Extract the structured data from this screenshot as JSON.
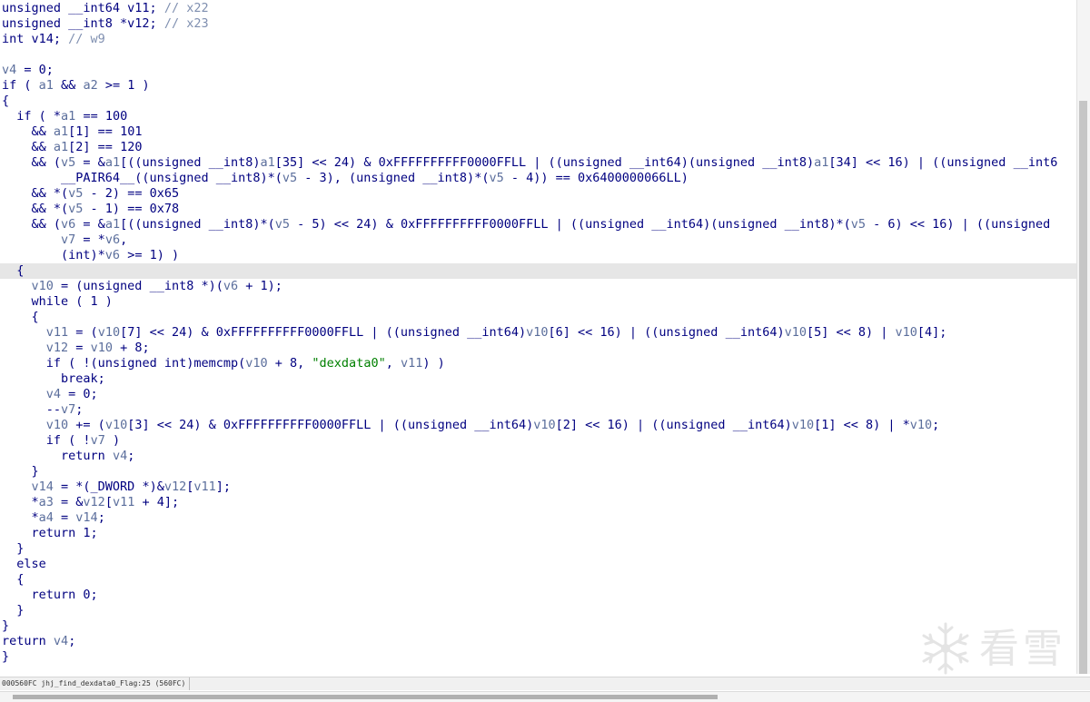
{
  "editor": {
    "highlighted_line": 17,
    "lines": [
      [
        [
          "kw",
          "unsigned __int64 v11; "
        ],
        [
          "cmt",
          "// x22"
        ]
      ],
      [
        [
          "kw",
          "unsigned __int8 *v12; "
        ],
        [
          "cmt",
          "// x23"
        ]
      ],
      [
        [
          "kw",
          "int v14; "
        ],
        [
          "cmt",
          "// w9"
        ]
      ],
      [],
      [
        [
          "var",
          "v4"
        ],
        [
          "txt",
          " = 0;"
        ]
      ],
      [
        [
          "kw",
          "if"
        ],
        [
          "txt",
          " ( "
        ],
        [
          "var",
          "a1"
        ],
        [
          "txt",
          " && "
        ],
        [
          "var",
          "a2"
        ],
        [
          "txt",
          " >= 1 )"
        ]
      ],
      [
        [
          "txt",
          "{"
        ]
      ],
      [
        [
          "txt",
          "  "
        ],
        [
          "kw",
          "if"
        ],
        [
          "txt",
          " ( *"
        ],
        [
          "var",
          "a1"
        ],
        [
          "txt",
          " == 100"
        ]
      ],
      [
        [
          "txt",
          "    && "
        ],
        [
          "var",
          "a1"
        ],
        [
          "txt",
          "[1] == 101"
        ]
      ],
      [
        [
          "txt",
          "    && "
        ],
        [
          "var",
          "a1"
        ],
        [
          "txt",
          "[2] == 120"
        ]
      ],
      [
        [
          "txt",
          "    && ("
        ],
        [
          "var",
          "v5"
        ],
        [
          "txt",
          " = &"
        ],
        [
          "var",
          "a1"
        ],
        [
          "txt",
          "[((unsigned __int8)"
        ],
        [
          "var",
          "a1"
        ],
        [
          "txt",
          "[35] << 24) & 0xFFFFFFFFFF0000FFLL | ((unsigned __int64)(unsigned __int8)"
        ],
        [
          "var",
          "a1"
        ],
        [
          "txt",
          "[34] << 16) | ((unsigned __int6"
        ]
      ],
      [
        [
          "txt",
          "        __PAIR64__((unsigned __int8)*("
        ],
        [
          "var",
          "v5"
        ],
        [
          "txt",
          " - 3), (unsigned __int8)*("
        ],
        [
          "var",
          "v5"
        ],
        [
          "txt",
          " - 4)) == 0x6400000066LL)"
        ]
      ],
      [
        [
          "txt",
          "    && *("
        ],
        [
          "var",
          "v5"
        ],
        [
          "txt",
          " - 2) == 0x65"
        ]
      ],
      [
        [
          "txt",
          "    && *("
        ],
        [
          "var",
          "v5"
        ],
        [
          "txt",
          " - 1) == 0x78"
        ]
      ],
      [
        [
          "txt",
          "    && ("
        ],
        [
          "var",
          "v6"
        ],
        [
          "txt",
          " = &"
        ],
        [
          "var",
          "a1"
        ],
        [
          "txt",
          "[((unsigned __int8)*("
        ],
        [
          "var",
          "v5"
        ],
        [
          "txt",
          " - 5) << 24) & 0xFFFFFFFFFF0000FFLL | ((unsigned __int64)(unsigned __int8)*("
        ],
        [
          "var",
          "v5"
        ],
        [
          "txt",
          " - 6) << 16) | ((unsigned"
        ]
      ],
      [
        [
          "txt",
          "        "
        ],
        [
          "var",
          "v7"
        ],
        [
          "txt",
          " = *"
        ],
        [
          "var",
          "v6"
        ],
        [
          "txt",
          ","
        ]
      ],
      [
        [
          "txt",
          "        (int)*"
        ],
        [
          "var",
          "v6"
        ],
        [
          "txt",
          " >= 1) )"
        ]
      ],
      [
        [
          "txt",
          "  {"
        ]
      ],
      [
        [
          "txt",
          "    "
        ],
        [
          "var",
          "v10"
        ],
        [
          "txt",
          " = (unsigned __int8 *)("
        ],
        [
          "var",
          "v6"
        ],
        [
          "txt",
          " + 1);"
        ]
      ],
      [
        [
          "txt",
          "    "
        ],
        [
          "kw",
          "while"
        ],
        [
          "txt",
          " ( 1 )"
        ]
      ],
      [
        [
          "txt",
          "    {"
        ]
      ],
      [
        [
          "txt",
          "      "
        ],
        [
          "var",
          "v11"
        ],
        [
          "txt",
          " = ("
        ],
        [
          "var",
          "v10"
        ],
        [
          "txt",
          "[7] << 24) & 0xFFFFFFFFFF0000FFLL | ((unsigned __int64)"
        ],
        [
          "var",
          "v10"
        ],
        [
          "txt",
          "[6] << 16) | ((unsigned __int64)"
        ],
        [
          "var",
          "v10"
        ],
        [
          "txt",
          "[5] << 8) | "
        ],
        [
          "var",
          "v10"
        ],
        [
          "txt",
          "[4];"
        ]
      ],
      [
        [
          "txt",
          "      "
        ],
        [
          "var",
          "v12"
        ],
        [
          "txt",
          " = "
        ],
        [
          "var",
          "v10"
        ],
        [
          "txt",
          " + 8;"
        ]
      ],
      [
        [
          "txt",
          "      "
        ],
        [
          "kw",
          "if"
        ],
        [
          "txt",
          " ( !(unsigned int)memcmp("
        ],
        [
          "var",
          "v10"
        ],
        [
          "txt",
          " + 8, "
        ],
        [
          "str",
          "\"dexdata0\""
        ],
        [
          "txt",
          ", "
        ],
        [
          "var",
          "v11"
        ],
        [
          "txt",
          ") )"
        ]
      ],
      [
        [
          "txt",
          "        "
        ],
        [
          "kw",
          "break"
        ],
        [
          "txt",
          ";"
        ]
      ],
      [
        [
          "txt",
          "      "
        ],
        [
          "var",
          "v4"
        ],
        [
          "txt",
          " = 0;"
        ]
      ],
      [
        [
          "txt",
          "      --"
        ],
        [
          "var",
          "v7"
        ],
        [
          "txt",
          ";"
        ]
      ],
      [
        [
          "txt",
          "      "
        ],
        [
          "var",
          "v10"
        ],
        [
          "txt",
          " += ("
        ],
        [
          "var",
          "v10"
        ],
        [
          "txt",
          "[3] << 24) & 0xFFFFFFFFFF0000FFLL | ((unsigned __int64)"
        ],
        [
          "var",
          "v10"
        ],
        [
          "txt",
          "[2] << 16) | ((unsigned __int64)"
        ],
        [
          "var",
          "v10"
        ],
        [
          "txt",
          "[1] << 8) | *"
        ],
        [
          "var",
          "v10"
        ],
        [
          "txt",
          ";"
        ]
      ],
      [
        [
          "txt",
          "      "
        ],
        [
          "kw",
          "if"
        ],
        [
          "txt",
          " ( !"
        ],
        [
          "var",
          "v7"
        ],
        [
          "txt",
          " )"
        ]
      ],
      [
        [
          "txt",
          "        "
        ],
        [
          "kw",
          "return"
        ],
        [
          "txt",
          " "
        ],
        [
          "var",
          "v4"
        ],
        [
          "txt",
          ";"
        ]
      ],
      [
        [
          "txt",
          "    }"
        ]
      ],
      [
        [
          "txt",
          "    "
        ],
        [
          "var",
          "v14"
        ],
        [
          "txt",
          " = *(_DWORD *)&"
        ],
        [
          "var",
          "v12"
        ],
        [
          "txt",
          "["
        ],
        [
          "var",
          "v11"
        ],
        [
          "txt",
          "];"
        ]
      ],
      [
        [
          "txt",
          "    *"
        ],
        [
          "var",
          "a3"
        ],
        [
          "txt",
          " = &"
        ],
        [
          "var",
          "v12"
        ],
        [
          "txt",
          "["
        ],
        [
          "var",
          "v11"
        ],
        [
          "txt",
          " + 4];"
        ]
      ],
      [
        [
          "txt",
          "    *"
        ],
        [
          "var",
          "a4"
        ],
        [
          "txt",
          " = "
        ],
        [
          "var",
          "v14"
        ],
        [
          "txt",
          ";"
        ]
      ],
      [
        [
          "txt",
          "    "
        ],
        [
          "kw",
          "return"
        ],
        [
          "txt",
          " 1;"
        ]
      ],
      [
        [
          "txt",
          "  }"
        ]
      ],
      [
        [
          "txt",
          "  "
        ],
        [
          "kw",
          "else"
        ]
      ],
      [
        [
          "txt",
          "  {"
        ]
      ],
      [
        [
          "txt",
          "    "
        ],
        [
          "kw",
          "return"
        ],
        [
          "txt",
          " 0;"
        ]
      ],
      [
        [
          "txt",
          "  }"
        ]
      ],
      [
        [
          "txt",
          "}"
        ]
      ],
      [
        [
          "kw",
          "return"
        ],
        [
          "txt",
          " "
        ],
        [
          "var",
          "v4"
        ],
        [
          "txt",
          ";"
        ]
      ],
      [
        [
          "txt",
          "}"
        ]
      ]
    ]
  },
  "status": {
    "text": "000560FC jhj_find_dexdata0_Flag:25 (560FC)"
  },
  "watermark": {
    "text": "看雪"
  },
  "scrollbars": {
    "vertical_position": 0.15,
    "vertical_visible_fraction": 0.85,
    "horizontal_position": 0.0,
    "horizontal_visible_fraction": 0.66
  }
}
